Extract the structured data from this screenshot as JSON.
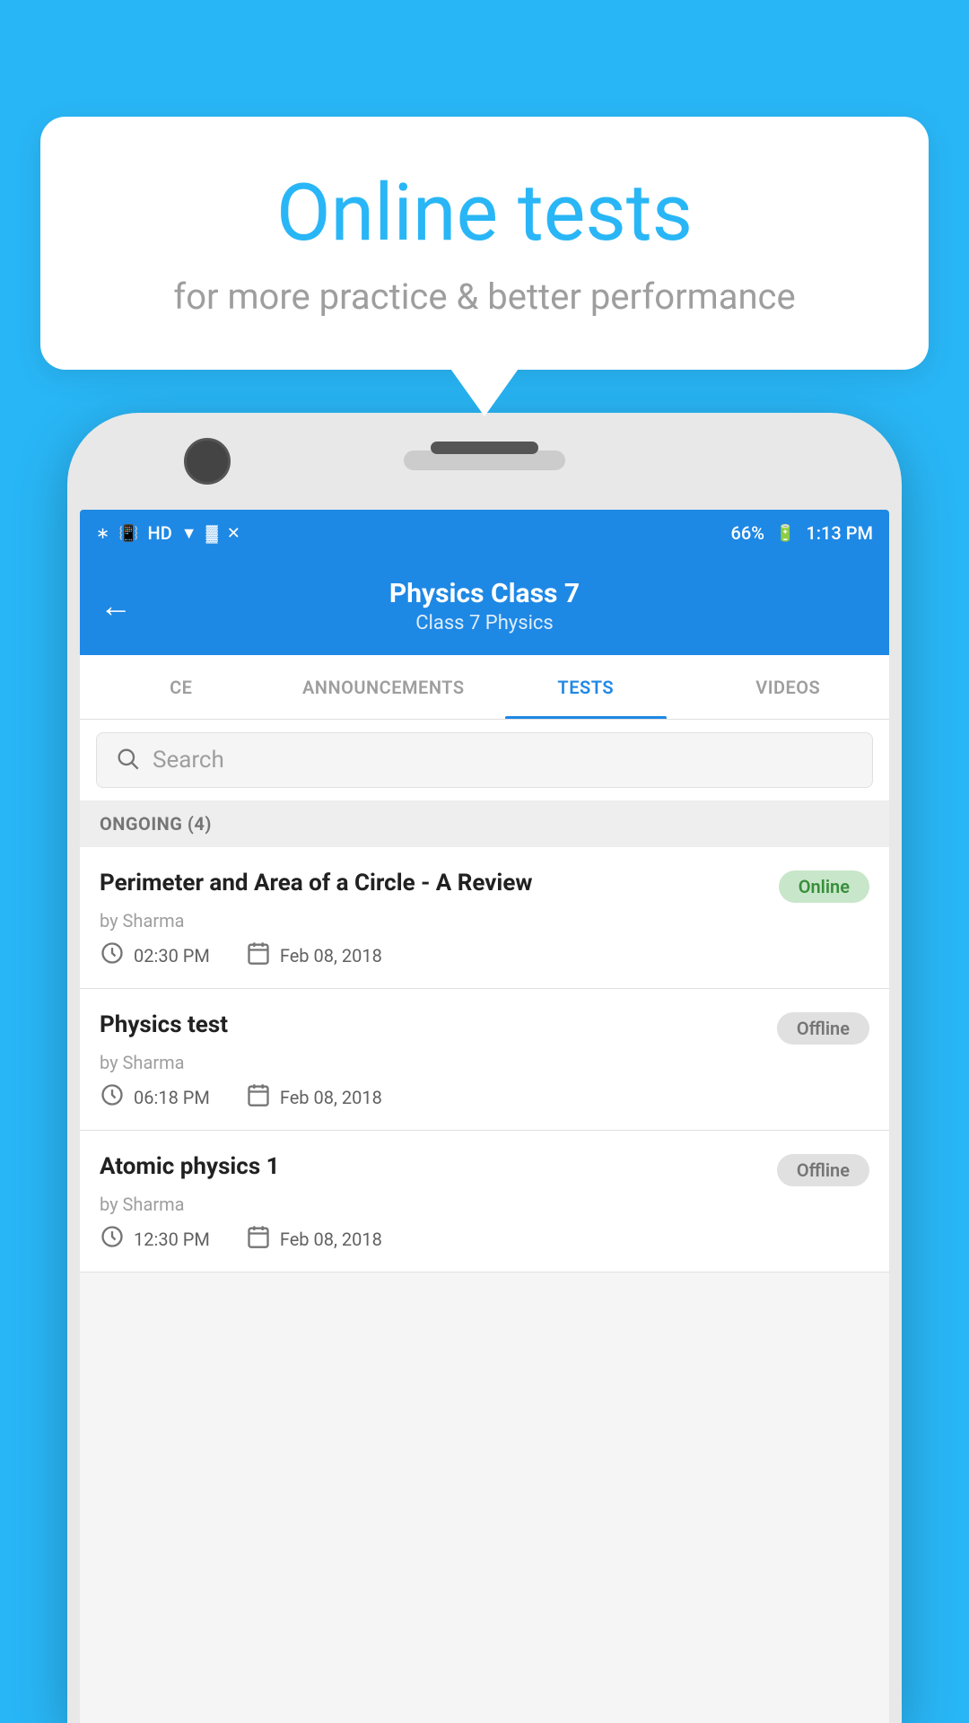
{
  "background_color": "#29b6f6",
  "tooltip": {
    "title": "Online tests",
    "subtitle": "for more practice & better performance"
  },
  "status_bar": {
    "time": "1:13 PM",
    "battery": "66%",
    "icons": [
      "bluetooth",
      "vibrate",
      "hd",
      "wifi",
      "signal",
      "x-signal"
    ]
  },
  "app_bar": {
    "title": "Physics Class 7",
    "subtitle": "Class 7   Physics",
    "back_label": "←"
  },
  "tabs": [
    {
      "label": "CE",
      "active": false
    },
    {
      "label": "ANNOUNCEMENTS",
      "active": false
    },
    {
      "label": "TESTS",
      "active": true
    },
    {
      "label": "VIDEOS",
      "active": false
    }
  ],
  "search": {
    "placeholder": "Search"
  },
  "section": {
    "label": "ONGOING (4)"
  },
  "tests": [
    {
      "title": "Perimeter and Area of a Circle - A Review",
      "author": "by Sharma",
      "time": "02:30 PM",
      "date": "Feb 08, 2018",
      "status": "Online",
      "status_type": "online"
    },
    {
      "title": "Physics test",
      "author": "by Sharma",
      "time": "06:18 PM",
      "date": "Feb 08, 2018",
      "status": "Offline",
      "status_type": "offline"
    },
    {
      "title": "Atomic physics 1",
      "author": "by Sharma",
      "time": "12:30 PM",
      "date": "Feb 08, 2018",
      "status": "Offline",
      "status_type": "offline"
    }
  ]
}
